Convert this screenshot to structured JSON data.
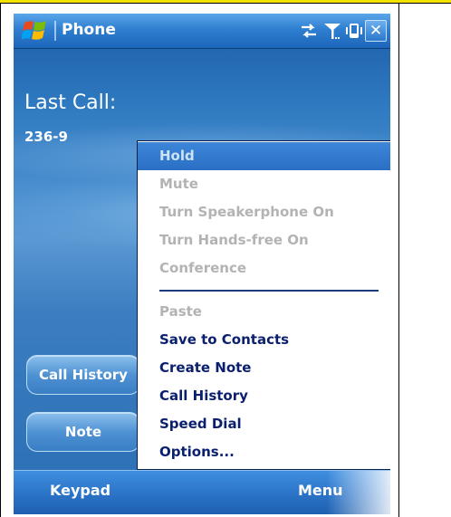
{
  "app": {
    "title": "Phone"
  },
  "status_icons": [
    "data-sync-icon",
    "signal-antenna-icon",
    "vibrate-icon"
  ],
  "close_label": "✕",
  "last_call": {
    "label": "Last Call:",
    "number": "236-9"
  },
  "buttons": {
    "call_history": "Call History",
    "note": "Note"
  },
  "menu": {
    "items": [
      {
        "label": "Hold",
        "state": "selected"
      },
      {
        "label": "Mute",
        "state": "disabled"
      },
      {
        "label": "Turn Speakerphone On",
        "state": "disabled"
      },
      {
        "label": "Turn Hands-free On",
        "state": "disabled"
      },
      {
        "label": "Conference",
        "state": "disabled"
      },
      {
        "label": "Paste",
        "state": "disabled"
      },
      {
        "label": "Save to Contacts",
        "state": "enabled"
      },
      {
        "label": "Create Note",
        "state": "enabled"
      },
      {
        "label": "Call History",
        "state": "enabled"
      },
      {
        "label": "Speed Dial",
        "state": "enabled"
      },
      {
        "label": "Options...",
        "state": "enabled"
      }
    ]
  },
  "softkeys": {
    "left": "Keypad",
    "right": "Menu"
  },
  "colors": {
    "accent": "#2a72c6",
    "menu_text": "#0a1f6e",
    "disabled_text": "#b3b3b3",
    "highlight": "#3d86d8"
  }
}
